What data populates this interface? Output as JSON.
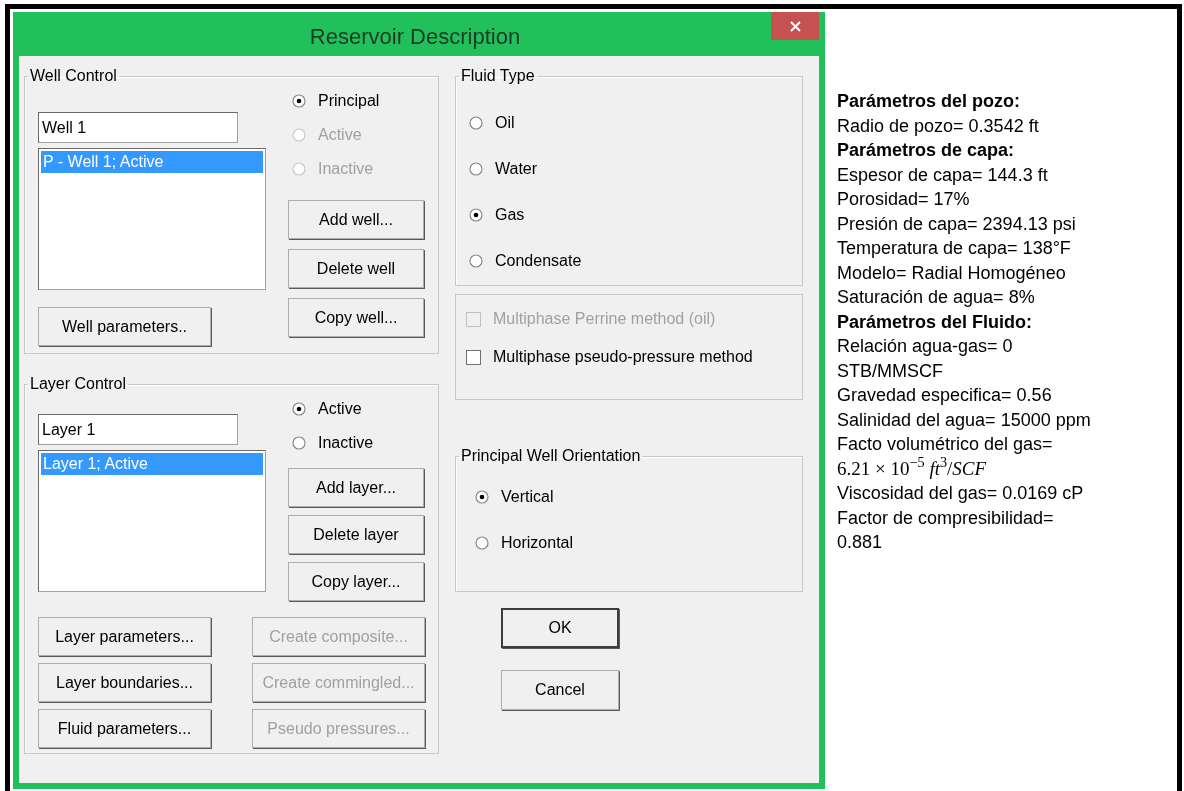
{
  "window": {
    "title": "Reservoir Description"
  },
  "well_control": {
    "title": "Well Control",
    "name_field": "Well 1",
    "list": [
      {
        "label": "P - Well 1; Active",
        "selected": true
      }
    ],
    "radios": [
      {
        "label": "Principal",
        "selected": true,
        "disabled": false
      },
      {
        "label": "Active",
        "selected": false,
        "disabled": true
      },
      {
        "label": "Inactive",
        "selected": false,
        "disabled": true
      }
    ],
    "buttons": [
      {
        "label": "Add well...",
        "disabled": false
      },
      {
        "label": "Delete well",
        "disabled": false
      },
      {
        "label": "Copy well...",
        "disabled": false
      }
    ],
    "parameters_button": {
      "label": "Well parameters..",
      "disabled": false
    }
  },
  "layer_control": {
    "title": "Layer Control",
    "name_field": "Layer 1",
    "list": [
      {
        "label": "Layer 1; Active",
        "selected": true
      }
    ],
    "radios": [
      {
        "label": "Active",
        "selected": true,
        "disabled": false
      },
      {
        "label": "Inactive",
        "selected": false,
        "disabled": false
      }
    ],
    "buttons": [
      {
        "label": "Add layer...",
        "disabled": false
      },
      {
        "label": "Delete layer",
        "disabled": false
      },
      {
        "label": "Copy layer...",
        "disabled": false
      }
    ],
    "bottom_buttons": [
      {
        "label": "Layer parameters...",
        "disabled": false
      },
      {
        "label": "Create composite...",
        "disabled": true
      },
      {
        "label": "Layer boundaries...",
        "disabled": false
      },
      {
        "label": "Create commingled...",
        "disabled": true
      },
      {
        "label": "Fluid parameters...",
        "disabled": false
      },
      {
        "label": "Pseudo pressures...",
        "disabled": true
      }
    ]
  },
  "fluid_type": {
    "title": "Fluid Type",
    "options": [
      {
        "label": "Oil",
        "selected": false
      },
      {
        "label": "Water",
        "selected": false
      },
      {
        "label": "Gas",
        "selected": true
      },
      {
        "label": "Condensate",
        "selected": false
      }
    ]
  },
  "methods": [
    {
      "label": "Multiphase Perrine method (oil)",
      "checked": false,
      "disabled": true
    },
    {
      "label": "Multiphase pseudo-pressure method",
      "checked": false,
      "disabled": false
    }
  ],
  "orientation": {
    "title": "Principal Well Orientation",
    "options": [
      {
        "label": "Vertical",
        "selected": true
      },
      {
        "label": "Horizontal",
        "selected": false
      }
    ]
  },
  "dialog_buttons": [
    {
      "label": "OK",
      "default": true
    },
    {
      "label": "Cancel",
      "default": false
    }
  ],
  "notes": [
    {
      "kind": "heading",
      "text": "Parámetros del pozo:"
    },
    {
      "kind": "line",
      "text": "Radio de pozo= 0.3542 ft"
    },
    {
      "kind": "heading",
      "text": "Parámetros de capa:"
    },
    {
      "kind": "line",
      "text": "Espesor de capa= 144.3 ft"
    },
    {
      "kind": "line",
      "text": "Porosidad= 17%"
    },
    {
      "kind": "line",
      "text": "Presión de capa= 2394.13 psi"
    },
    {
      "kind": "line",
      "text": "Temperatura de capa= 138°F"
    },
    {
      "kind": "line",
      "text": "Modelo= Radial Homogéneo"
    },
    {
      "kind": "line",
      "text": "Saturación de agua= 8%"
    },
    {
      "kind": "heading",
      "text": "Parámetros del Fluido:"
    },
    {
      "kind": "line",
      "text": "Relación agua-gas= 0"
    },
    {
      "kind": "line",
      "text": "STB/MMSCF"
    },
    {
      "kind": "line",
      "text": "Gravedad especifica= 0.56"
    },
    {
      "kind": "line",
      "text": "Salinidad del agua= 15000 ppm"
    },
    {
      "kind": "line",
      "text": "Facto volumétrico del gas="
    },
    {
      "kind": "math",
      "text": "6.21 × 10$^{−5}$ *ft*$^{3}$/*SCF*"
    },
    {
      "kind": "line",
      "text": "Viscosidad del gas= 0.0169 cP"
    },
    {
      "kind": "line",
      "text": "Factor de compresibilidad="
    },
    {
      "kind": "line",
      "text": "0.881"
    }
  ]
}
